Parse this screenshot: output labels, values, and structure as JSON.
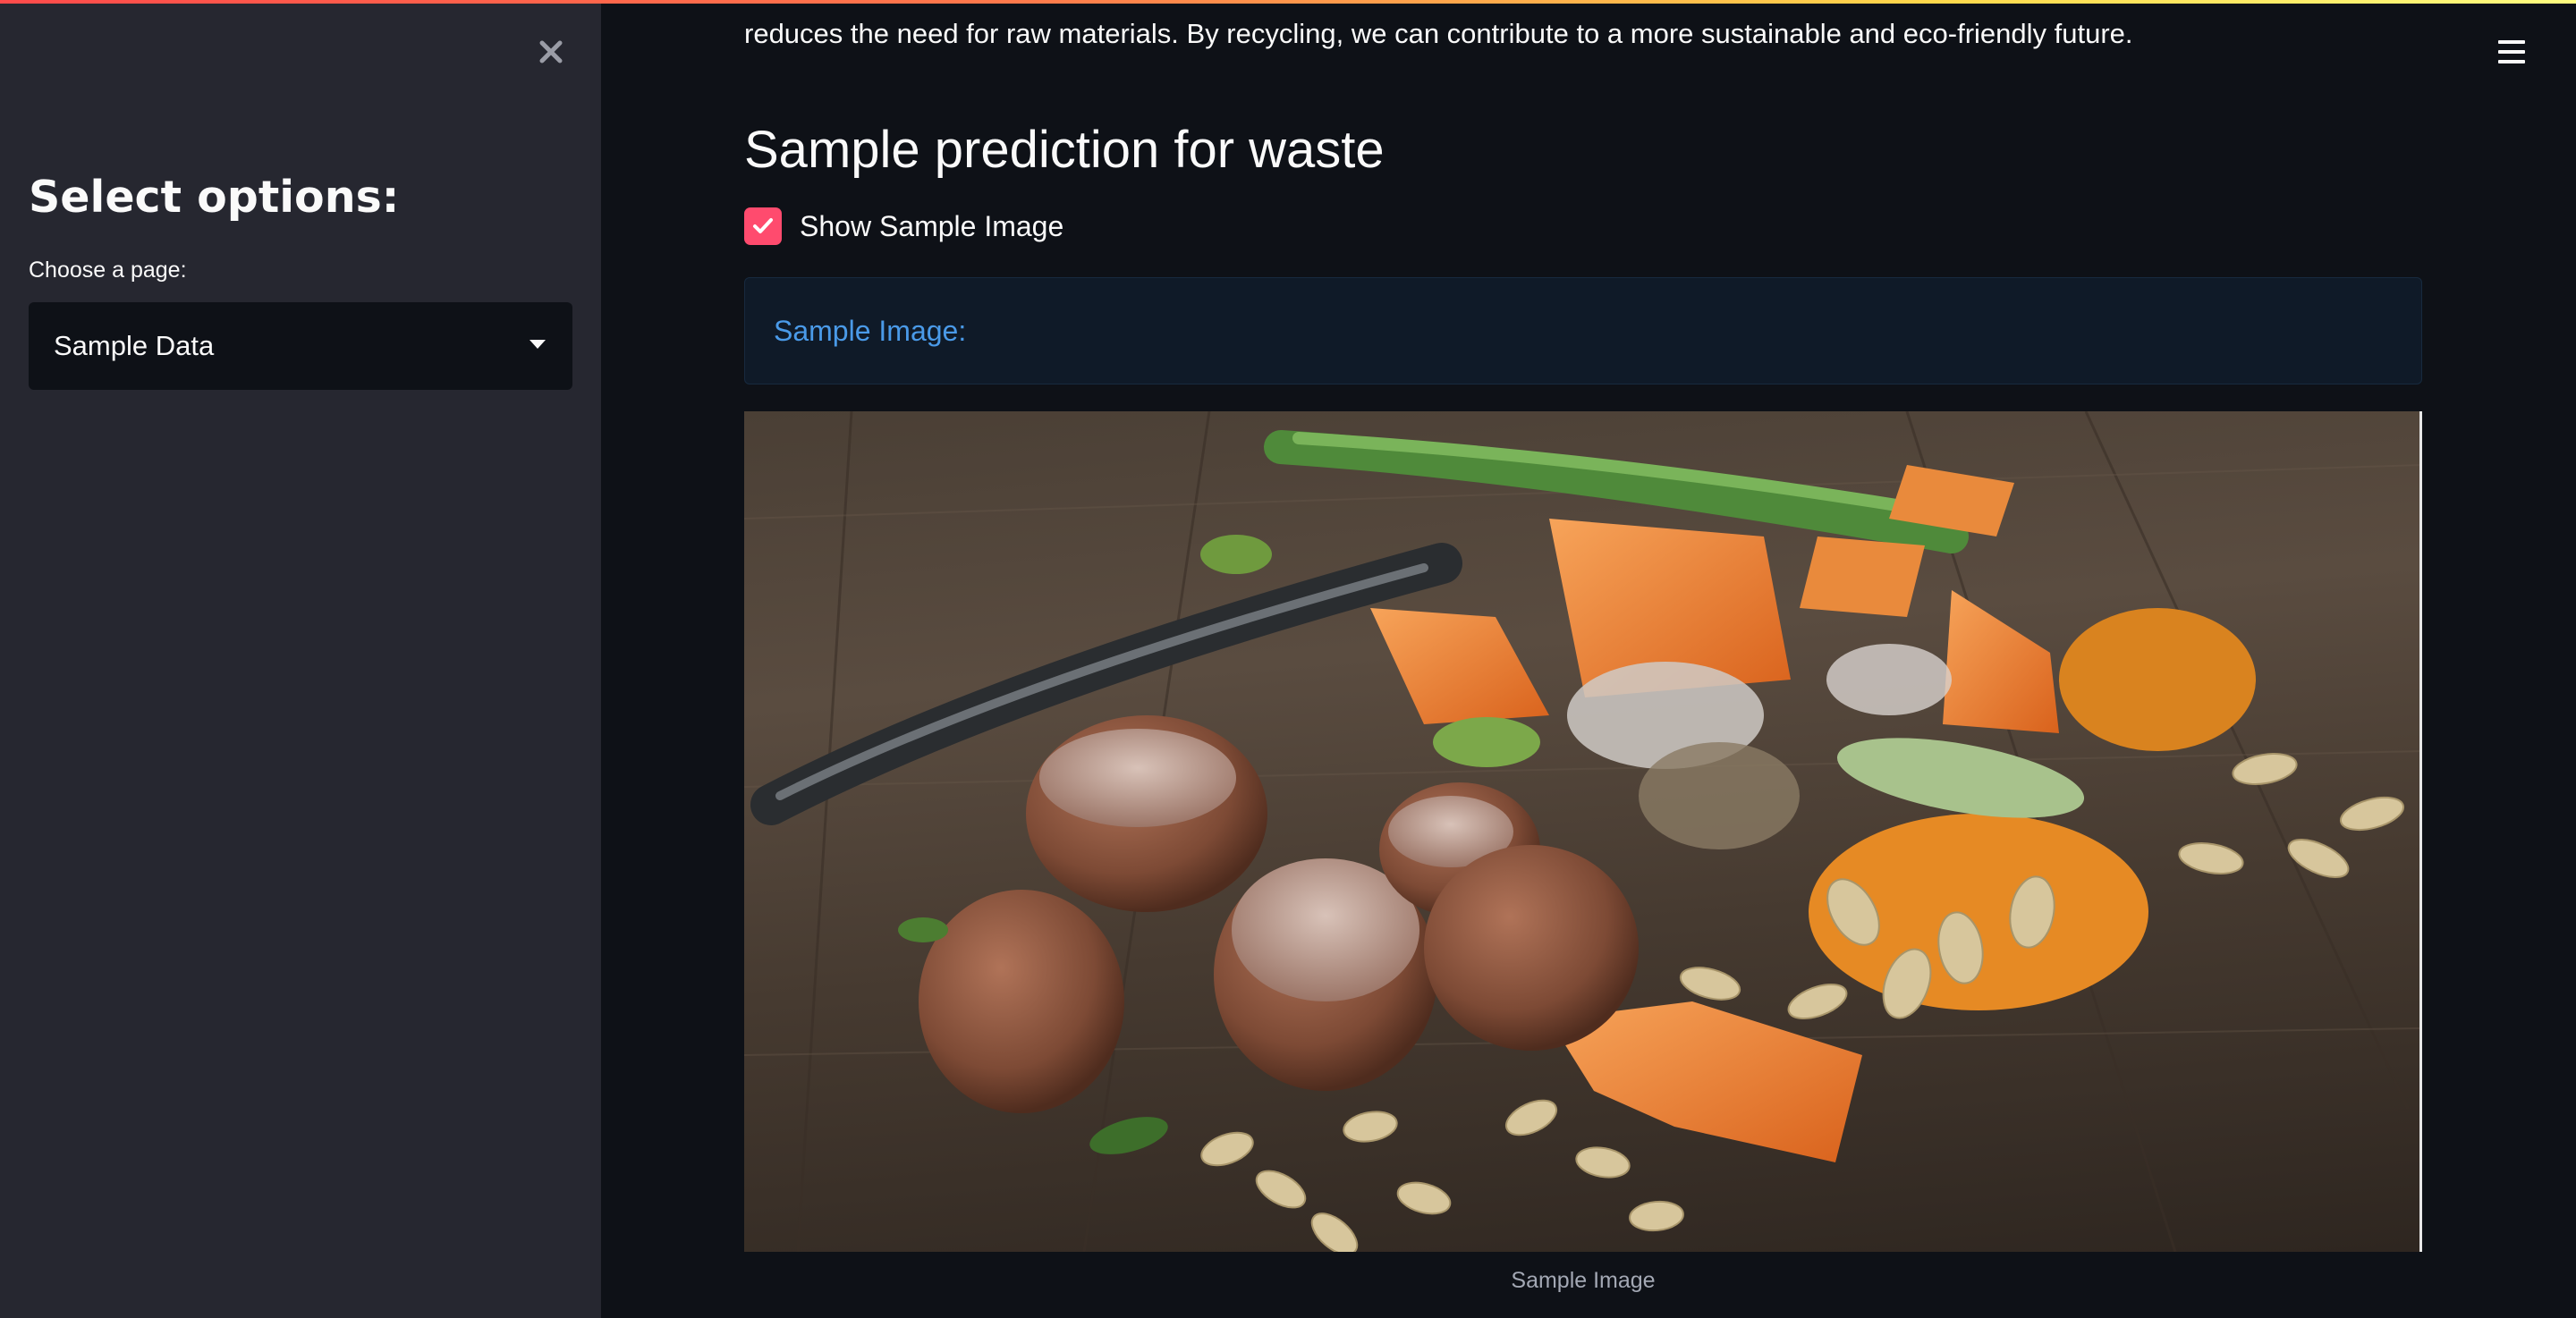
{
  "sidebar": {
    "close_icon": "close-icon",
    "title": "Select options:",
    "select_label": "Choose a page:",
    "select_value": "Sample Data"
  },
  "header": {
    "menu_icon": "hamburger-menu-icon"
  },
  "main": {
    "intro_line": "reduces the need for raw materials. By recycling, we can contribute to a more sustainable and eco-friendly future.",
    "section_heading": "Sample prediction for waste",
    "checkbox_label": "Show Sample Image",
    "checkbox_checked": true,
    "info_text": "Sample Image:",
    "image_caption": "Sample Image"
  },
  "colors": {
    "accent": "#ff4b6e",
    "info_text": "#4a9ae8",
    "sidebar_bg": "#262730",
    "main_bg": "#0e1117"
  }
}
